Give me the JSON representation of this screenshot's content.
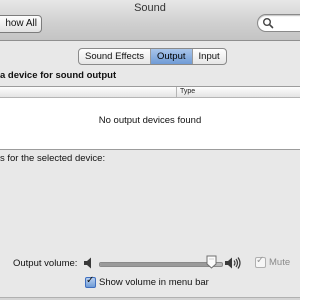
{
  "window": {
    "title": "Sound"
  },
  "toolbar": {
    "show_all_label": "how All",
    "search": {
      "value": "",
      "icon": "search-icon"
    }
  },
  "tabs": [
    {
      "label": "Sound Effects",
      "selected": false
    },
    {
      "label": "Output",
      "selected": true
    },
    {
      "label": "Input",
      "selected": false
    }
  ],
  "output": {
    "heading": "a device for sound output",
    "table": {
      "columns": [
        "",
        "Type"
      ],
      "rows": [],
      "empty_message": "No output devices found"
    },
    "settings_label": "s for the selected device:"
  },
  "volume": {
    "label": "Output volume:",
    "level": 0.93,
    "mute_label": "Mute",
    "mute_checked": true,
    "mute_enabled": false,
    "menubar_label": "Show volume in menu bar",
    "menubar_checked": true
  },
  "colors": {
    "selected_tab": "#6f9bd6",
    "window_bg": "#e8e8e8",
    "disabled_text": "#8a8a8a"
  }
}
